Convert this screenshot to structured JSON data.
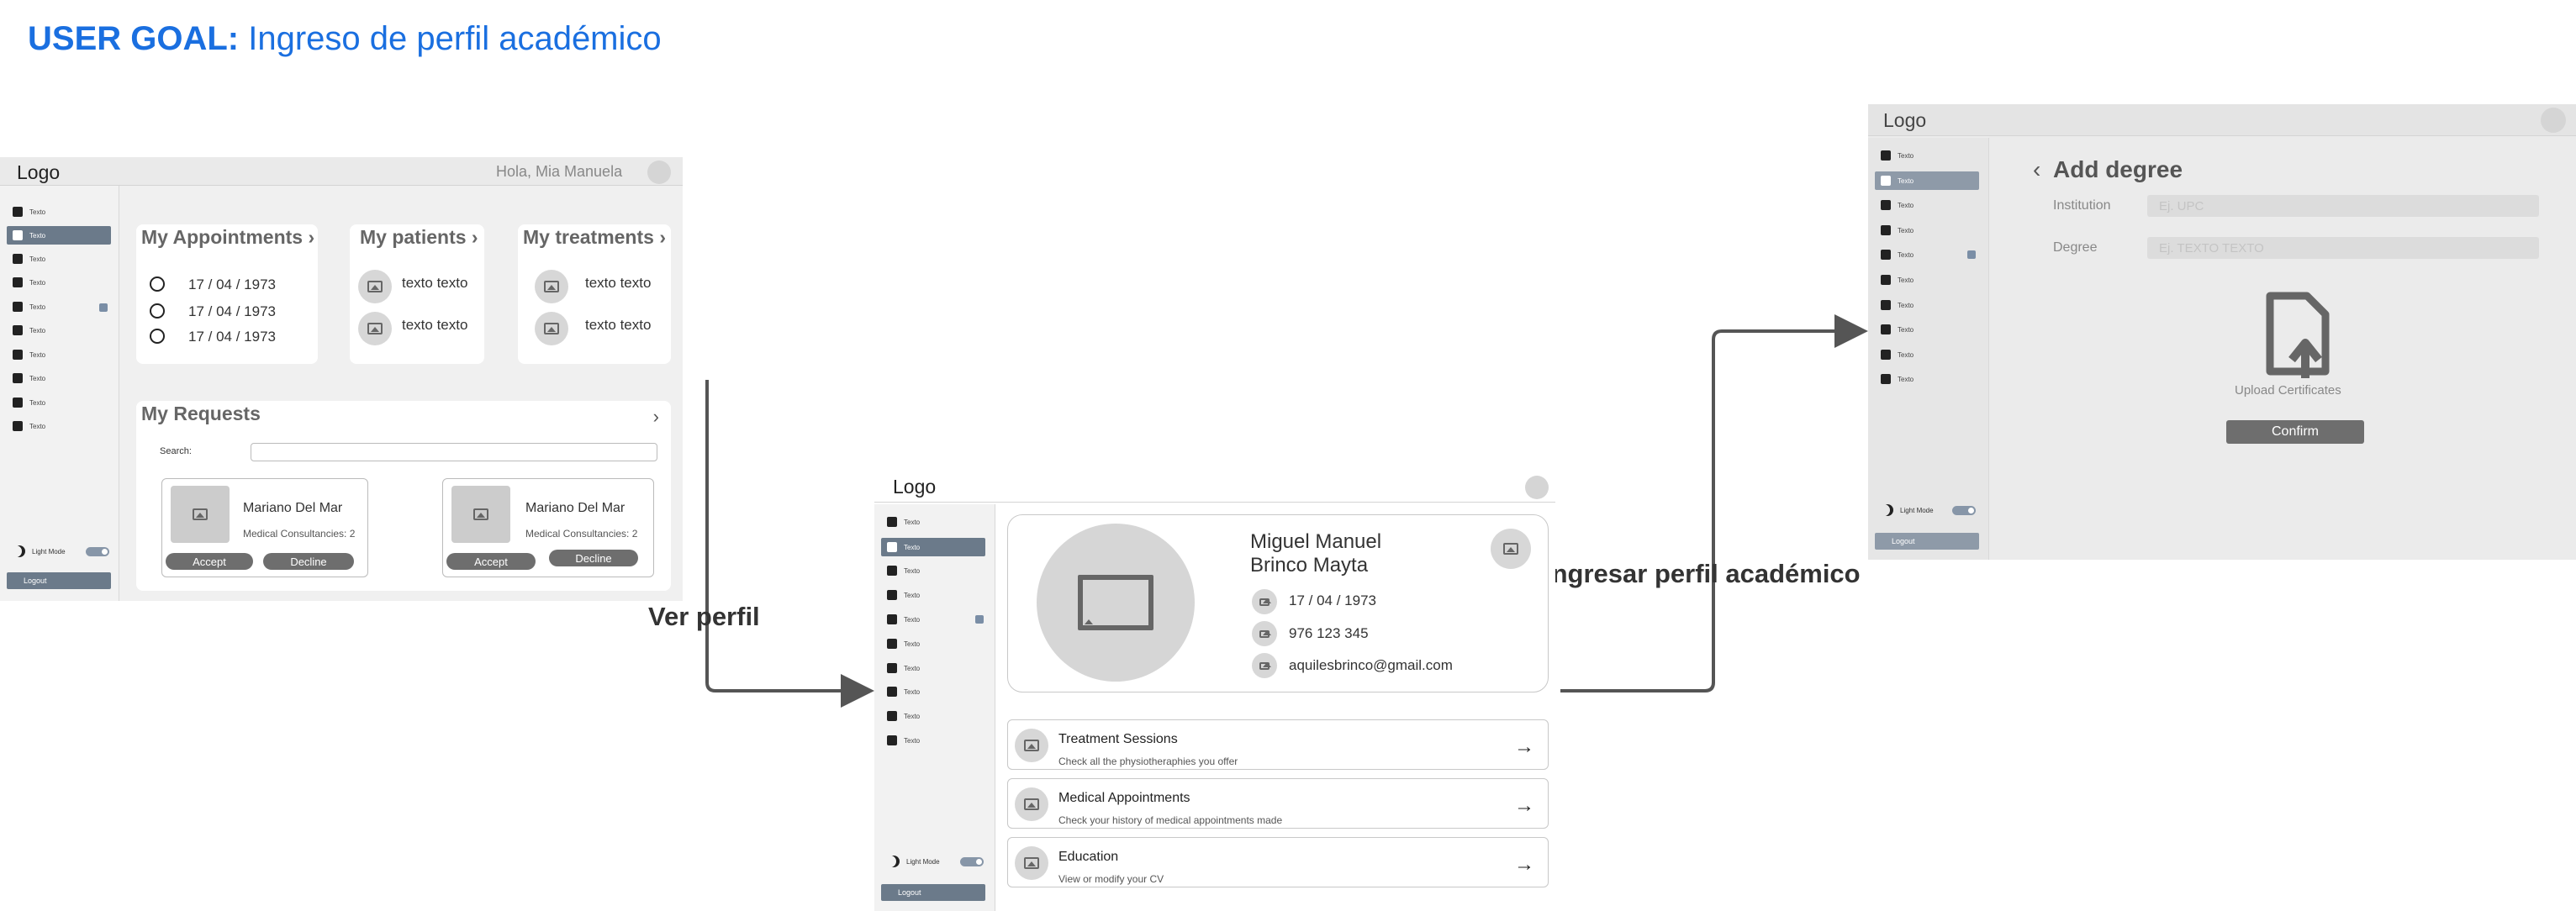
{
  "goal": {
    "prefix": "USER GOAL:",
    "text": "Ingreso de perfil académico"
  },
  "flow": {
    "label_1": "Ver perfil",
    "label_2": "Ingresar perfil académico"
  },
  "sidebar": {
    "items": [
      "Texto",
      "Texto",
      "Texto",
      "Texto",
      "Texto",
      "Texto",
      "Texto",
      "Texto",
      "Texto",
      "Texto"
    ],
    "light_mode": "Light Mode",
    "logout": "Logout"
  },
  "screen1": {
    "logo": "Logo",
    "greeting": "Hola, Mia Manuela",
    "appointments": {
      "title": "My Appointments ›",
      "dates": [
        "17 / 04 / 1973",
        "17 / 04 / 1973",
        "17 / 04 / 1973"
      ]
    },
    "patients": {
      "title": "My patients ›",
      "items": [
        "texto texto",
        "texto texto"
      ]
    },
    "treatments": {
      "title": "My treatments ›",
      "items": [
        "texto texto",
        "texto texto"
      ]
    },
    "requests": {
      "title": "My Requests",
      "search_label": "Search:",
      "cards": [
        {
          "name": "Mariano Del Mar",
          "detail": "Medical Consultancies: 2",
          "accept": "Accept",
          "decline": "Decline"
        },
        {
          "name": "Mariano Del Mar",
          "detail": "Medical Consultancies: 2",
          "accept": "Accept",
          "decline": "Decline"
        }
      ]
    }
  },
  "screen2": {
    "logo": "Logo",
    "profile": {
      "name_line1": "Miguel Manuel",
      "name_line2": "Brinco Mayta",
      "birthdate": "17 / 04 / 1973",
      "phone": "976 123 345",
      "email": "aquilesbrinco@gmail.com"
    },
    "rows": [
      {
        "title": "Treatment Sessions",
        "subtitle": "Check all the physiotheraphies you offer"
      },
      {
        "title": "Medical Appointments",
        "subtitle": "Check your history of medical appointments made"
      },
      {
        "title": "Education",
        "subtitle": "View or modify your CV"
      }
    ]
  },
  "screen3": {
    "logo": "Logo",
    "title": "Add degree",
    "institution_label": "Institution",
    "institution_placeholder": "Ej. UPC",
    "degree_label": "Degree",
    "degree_placeholder": "Ej. TEXTO TEXTO",
    "upload_label": "Upload Certificates",
    "confirm": "Confirm"
  }
}
